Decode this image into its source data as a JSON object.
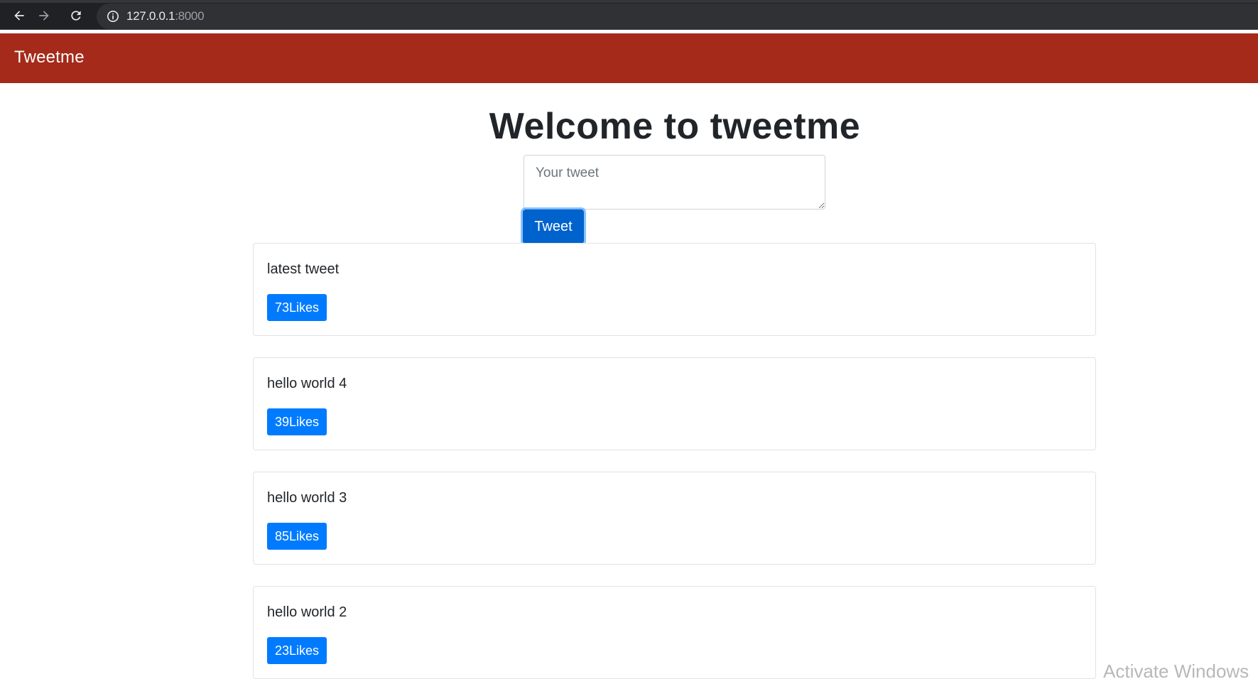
{
  "browser": {
    "url_host": "127.0.0.1",
    "url_port": ":8000",
    "icons": [
      "back-arrow-icon",
      "forward-arrow-icon",
      "reload-icon",
      "info-icon"
    ]
  },
  "navbar": {
    "brand": "Tweetme",
    "background_color": "#a52a1a"
  },
  "main": {
    "title": "Welcome to tweetme",
    "tweet_input": {
      "value": "",
      "placeholder": "Your tweet"
    },
    "tweet_button_label": "Tweet"
  },
  "tweets": [
    {
      "content": "latest tweet",
      "likes_label": "73Likes"
    },
    {
      "content": "hello world 4",
      "likes_label": "39Likes"
    },
    {
      "content": "hello world 3",
      "likes_label": "85Likes"
    },
    {
      "content": "hello world 2",
      "likes_label": "23Likes"
    }
  ],
  "system": {
    "watermark": "Activate Windows"
  },
  "colors": {
    "primary_button": "#007bff",
    "active_button": "#0062cc"
  }
}
